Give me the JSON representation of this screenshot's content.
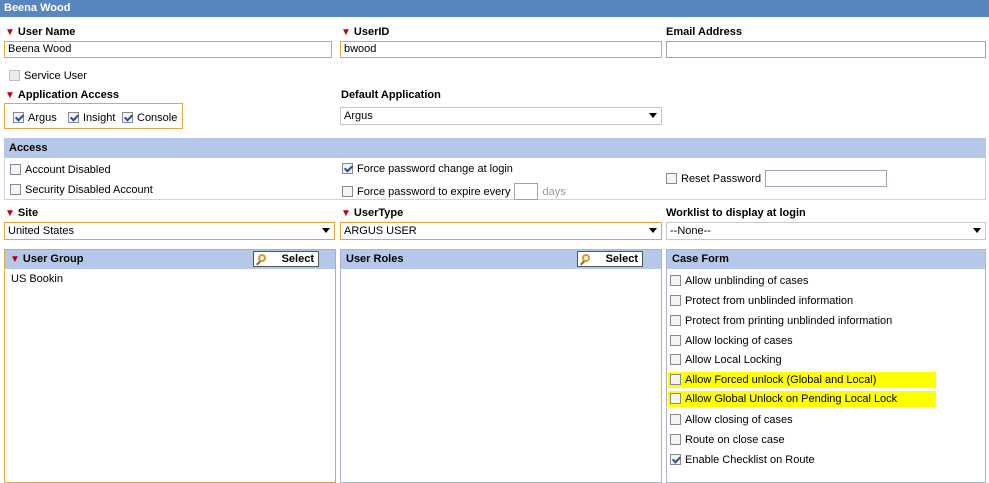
{
  "title": "Beena Wood",
  "fields": {
    "user_name_label": "User Name",
    "user_name_value": "Beena Wood",
    "userid_label": "UserID",
    "userid_value": "bwood",
    "email_label": "Email Address",
    "email_value": "",
    "service_user_label": "Service User",
    "app_access_label": "Application Access",
    "app_argus": "Argus",
    "app_insight": "Insight",
    "app_console": "Console",
    "default_app_label": "Default Application",
    "default_app_value": "Argus"
  },
  "access": {
    "header": "Access",
    "account_disabled": "Account Disabled",
    "security_disabled": "Security Disabled Account",
    "force_change": "Force password change at login",
    "force_expire": "Force password to expire every",
    "days": "days",
    "reset_password": "Reset Password"
  },
  "site": {
    "label": "Site",
    "value": "United States"
  },
  "usertype": {
    "label": "UserType",
    "value": "ARGUS USER"
  },
  "worklist": {
    "label": "Worklist to display at login",
    "value": "--None--"
  },
  "user_group": {
    "header": "User Group",
    "select": "Select",
    "items": [
      "US Bookin"
    ]
  },
  "user_roles": {
    "header": "User Roles",
    "select": "Select"
  },
  "case_form": {
    "header": "Case Form",
    "items": [
      {
        "label": "Allow unblinding of cases",
        "checked": false,
        "highlight": false
      },
      {
        "label": "Protect from unblinded information",
        "checked": false,
        "highlight": false
      },
      {
        "label": "Protect from printing unblinded information",
        "checked": false,
        "highlight": false
      },
      {
        "label": "Allow locking of cases",
        "checked": false,
        "highlight": false
      },
      {
        "label": "Allow Local Locking",
        "checked": false,
        "highlight": false
      },
      {
        "label": "Allow Forced unlock (Global and Local)",
        "checked": false,
        "highlight": true
      },
      {
        "label": "Allow  Global Unlock on Pending Local Lock",
        "checked": false,
        "highlight": true
      },
      {
        "label": "Allow closing of cases",
        "checked": false,
        "highlight": false
      },
      {
        "label": "Route on close case",
        "checked": false,
        "highlight": false
      },
      {
        "label": "Enable Checklist on Route",
        "checked": true,
        "highlight": false
      }
    ]
  }
}
